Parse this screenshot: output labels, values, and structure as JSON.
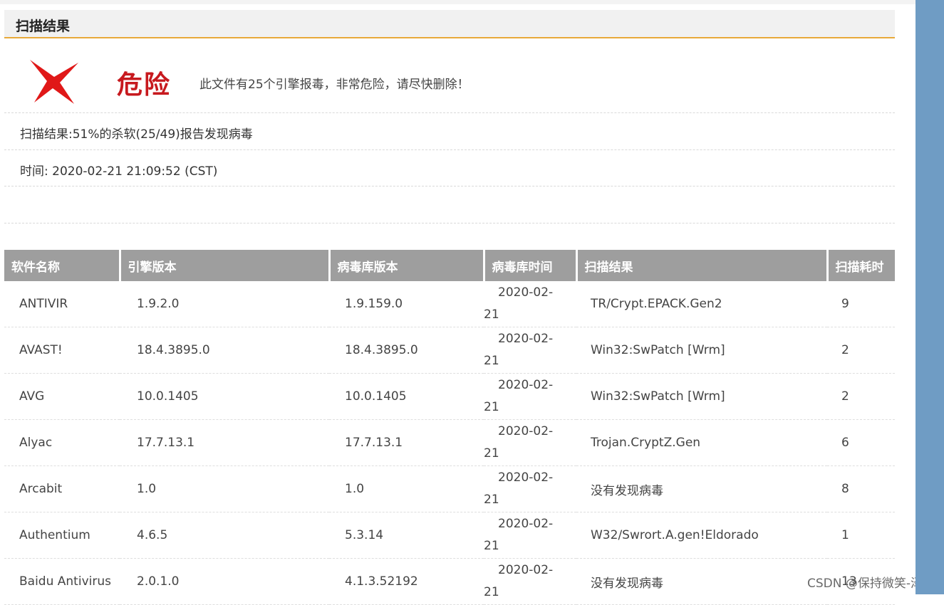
{
  "header": {
    "title": "扫描结果"
  },
  "verdict": {
    "icon": "danger-x-icon",
    "label": "危险",
    "message": "此文件有25个引擎报毒，非常危险，请尽快删除！",
    "color": "#c7191e"
  },
  "summary": {
    "result_text": "扫描结果:51%的杀软(25/49)报告发现病毒",
    "time_text": "时间: 2020-02-21 21:09:52 (CST)"
  },
  "table": {
    "columns": [
      "软件名称",
      "引擎版本",
      "病毒库版本",
      "病毒库时间",
      "扫描结果",
      "扫描耗时"
    ],
    "rows": [
      {
        "name": "ANTIVIR",
        "engine": "1.9.2.0",
        "db": "1.9.159.0",
        "time_a": "2020-02-",
        "time_b": "21",
        "result": "TR/Crypt.EPACK.Gen2",
        "status": "danger",
        "duration": "9"
      },
      {
        "name": "AVAST!",
        "engine": "18.4.3895.0",
        "db": "18.4.3895.0",
        "time_a": "2020-02-",
        "time_b": "21",
        "result": "Win32:SwPatch [Wrm]",
        "status": "danger",
        "duration": "2"
      },
      {
        "name": "AVG",
        "engine": "10.0.1405",
        "db": "10.0.1405",
        "time_a": "2020-02-",
        "time_b": "21",
        "result": "Win32:SwPatch [Wrm]",
        "status": "danger",
        "duration": "2"
      },
      {
        "name": "Alyac",
        "engine": "17.7.13.1",
        "db": "17.7.13.1",
        "time_a": "2020-02-",
        "time_b": "21",
        "result": "Trojan.CryptZ.Gen",
        "status": "danger",
        "duration": "6"
      },
      {
        "name": "Arcabit",
        "engine": "1.0",
        "db": "1.0",
        "time_a": "2020-02-",
        "time_b": "21",
        "result": "没有发现病毒",
        "status": "safe",
        "duration": "8"
      },
      {
        "name": "Authentium",
        "engine": "4.6.5",
        "db": "5.3.14",
        "time_a": "2020-02-",
        "time_b": "21",
        "result": "W32/Swrort.A.gen!Eldorado",
        "status": "danger",
        "duration": "1"
      },
      {
        "name": "Baidu Antivirus",
        "engine": "2.0.1.0",
        "db": "4.1.3.52192",
        "time_a": "2020-02-",
        "time_b": "21",
        "result": "没有发现病毒",
        "status": "safe",
        "duration": "13"
      }
    ]
  },
  "watermark": "CSDN @保持微笑-泽",
  "colors": {
    "header_underline": "#e8a93a",
    "table_header_bg": "#9e9e9e",
    "danger_result": "#a4162a",
    "safe_result": "#2e8b1e",
    "scrollbar_blue": "#6f9cc4"
  }
}
